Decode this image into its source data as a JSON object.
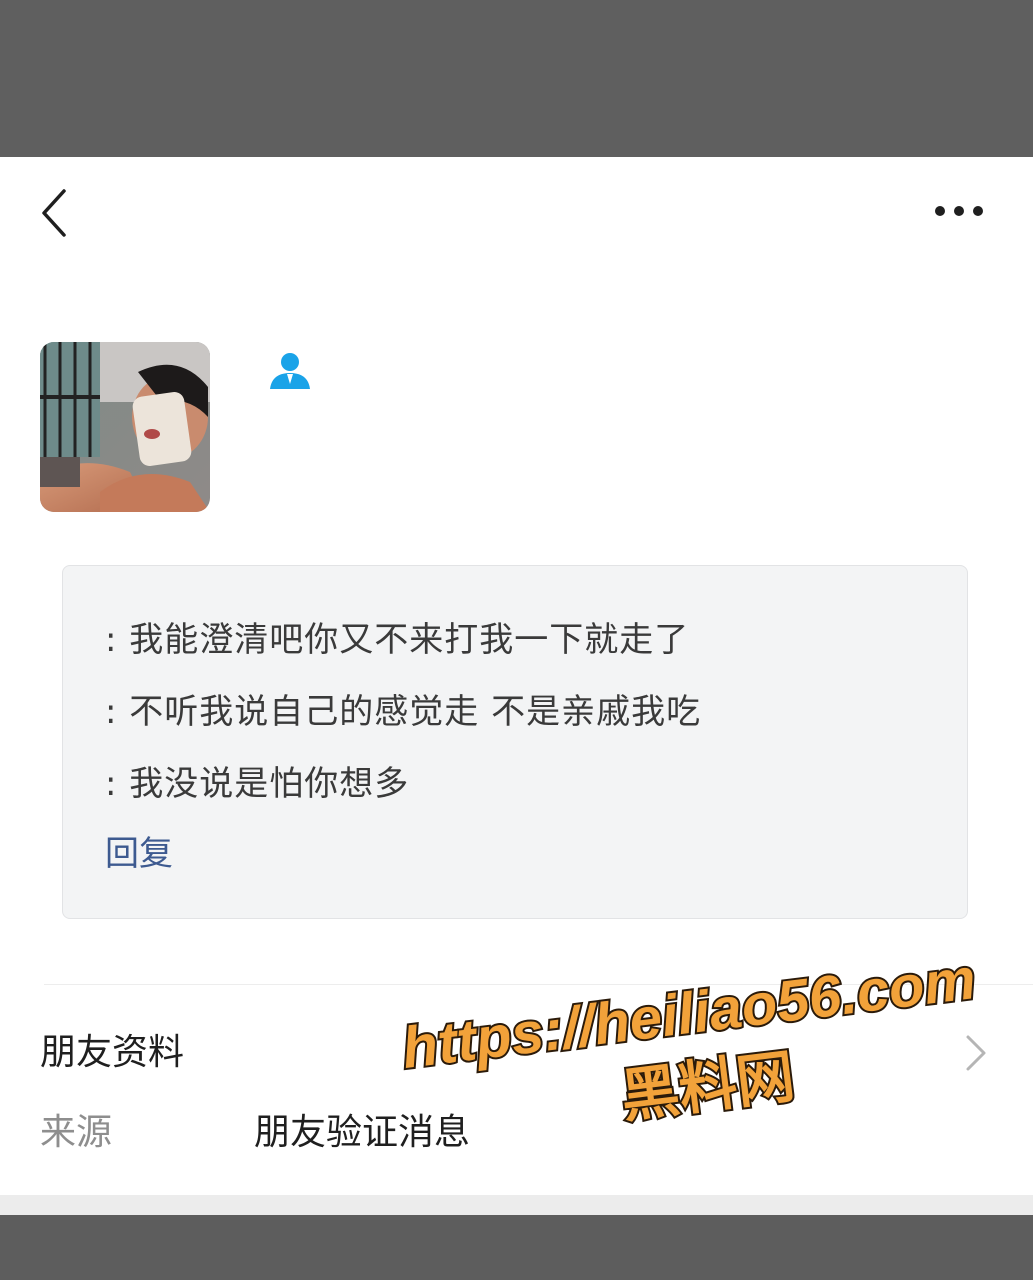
{
  "header": {
    "back_icon": "chevron-left-icon",
    "more_icon": "more-dots-icon"
  },
  "profile": {
    "badge_icon": "person-icon",
    "badge_color": "#1aa3e8"
  },
  "message_card": {
    "lines": [
      ": 我能澄清吧你又不来打我一下就走了",
      ": 不听我说自己的感觉走 不是亲戚我吃",
      ": 我没说是怕你想多"
    ],
    "reply_label": "回复",
    "link_color": "#3d5a90"
  },
  "friend_info": {
    "profile_label": "朋友资料",
    "source_label": "来源",
    "source_value": "朋友验证消息"
  },
  "watermark": {
    "url": "https://heiliao56.com",
    "name": "黑料网"
  }
}
